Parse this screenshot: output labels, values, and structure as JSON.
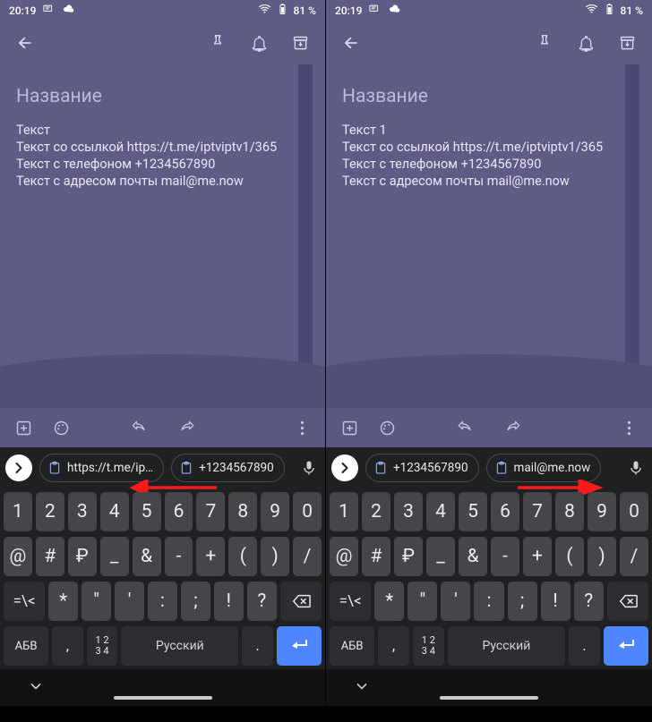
{
  "statusbar": {
    "time": "20:19",
    "battery": "81 %"
  },
  "note": {
    "title_placeholder": "Название",
    "left_body": "Текст\nТекст со ссылкой https://t.me/iptviptv1/365\nТекст с телефоном +1234567890\nТекст с адресом почты mail@me.now",
    "right_body": "Текст 1\nТекст со ссылкой https://t.me/iptviptv1/365\nТекст с телефоном +1234567890\nТекст с адресом почты mail@me.now"
  },
  "suggestions": {
    "left": [
      {
        "text": "https://t.me/ip…"
      },
      {
        "text": "+1234567890"
      }
    ],
    "right": [
      {
        "text": "+1234567890"
      },
      {
        "text": "mail@me.now"
      }
    ]
  },
  "keyboard": {
    "row1": [
      "1",
      "2",
      "3",
      "4",
      "5",
      "6",
      "7",
      "8",
      "9",
      "0"
    ],
    "row2": [
      "@",
      "#",
      "₽",
      "_",
      "&",
      "-",
      "+",
      "(",
      ")",
      "/"
    ],
    "row3_toggle": "=\\<",
    "row3": [
      "*",
      "\"",
      "'",
      ":",
      ";",
      "!",
      "?"
    ],
    "row4": {
      "lang_toggle": "АБВ",
      "comma": ",",
      "numpad": "1 2\n3 4",
      "space": "Русский",
      "dot": "."
    }
  }
}
